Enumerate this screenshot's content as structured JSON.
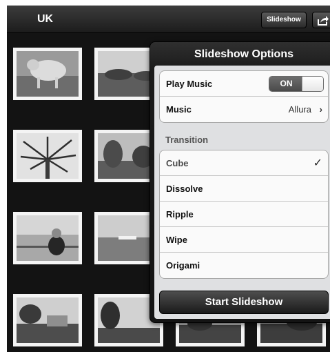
{
  "navbar": {
    "title": "UK",
    "slideshow_label": "Slideshow",
    "share_icon": "share-icon"
  },
  "thumbnails": [
    {
      "subject": "sheep"
    },
    {
      "subject": "landscape"
    },
    {
      "subject": "palm-tree"
    },
    {
      "subject": "garden-palms"
    },
    {
      "subject": "person-at-sea"
    },
    {
      "subject": "ship-at-sea"
    },
    {
      "subject": "garden-building"
    },
    {
      "subject": "trees-hill"
    },
    {
      "subject": "garden-path"
    },
    {
      "subject": "bushes"
    }
  ],
  "popover": {
    "title": "Slideshow Options",
    "play_music": {
      "label": "Play Music",
      "toggle_label": "ON",
      "state": true
    },
    "music": {
      "label": "Music",
      "value": "Allura"
    },
    "transition_header": "Transition",
    "transitions": [
      {
        "label": "Cube",
        "selected": true
      },
      {
        "label": "Dissolve",
        "selected": false
      },
      {
        "label": "Ripple",
        "selected": false
      },
      {
        "label": "Wipe",
        "selected": false
      },
      {
        "label": "Origami",
        "selected": false
      }
    ],
    "start_label": "Start Slideshow"
  },
  "colors": {
    "background": "#131313",
    "navbar": "#2a2a2a",
    "popover_body": "#dfe0e2",
    "toggle_on": "#5a5a5a"
  }
}
